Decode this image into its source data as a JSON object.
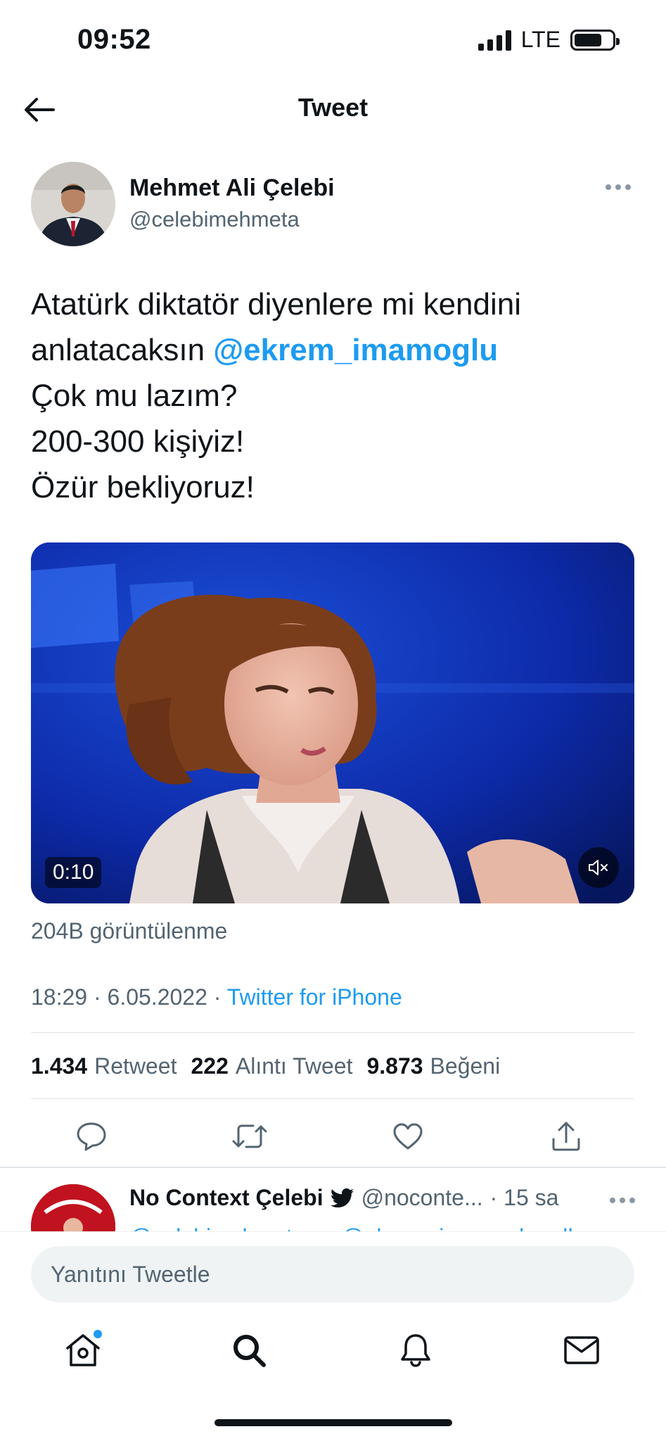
{
  "status_bar": {
    "time": "09:52",
    "network": "LTE"
  },
  "header": {
    "title": "Tweet"
  },
  "tweet": {
    "author_name": "Mehmet Ali Çelebi",
    "author_handle": "@celebimehmeta",
    "text_line1": "Atatürk diktatör diyenlere mi kendini",
    "text_line2_prefix": "anlatacaksın ",
    "mention": "@ekrem_imamoglu",
    "text_line3": "Çok mu lazım?",
    "text_line4": "200-300 kişiyiz!",
    "text_line5": "Özür bekliyoruz!",
    "video_duration": "0:10",
    "views": "204B görüntülenme",
    "time": "18:29",
    "date": "6.05.2022",
    "separator": "·",
    "source": "Twitter for iPhone",
    "stats": {
      "retweets": "1.434",
      "retweets_label": "Retweet",
      "quotes": "222",
      "quotes_label": "Alıntı Tweet",
      "likes": "9.873",
      "likes_label": "Beğeni"
    }
  },
  "reply": {
    "name": "No Context Çelebi",
    "handle": "@noconte...",
    "time": "· 15 sa",
    "text": "@celebimehmeta ve @ekrem_imamoglu adlı"
  },
  "composer": {
    "placeholder": "Yanıtını Tweetle"
  },
  "tabs": [
    "home-icon",
    "search-icon",
    "notifications-icon",
    "messages-icon"
  ],
  "colors": {
    "accent": "#1d9bf0",
    "text": "#0f1419",
    "muted": "#536471"
  }
}
